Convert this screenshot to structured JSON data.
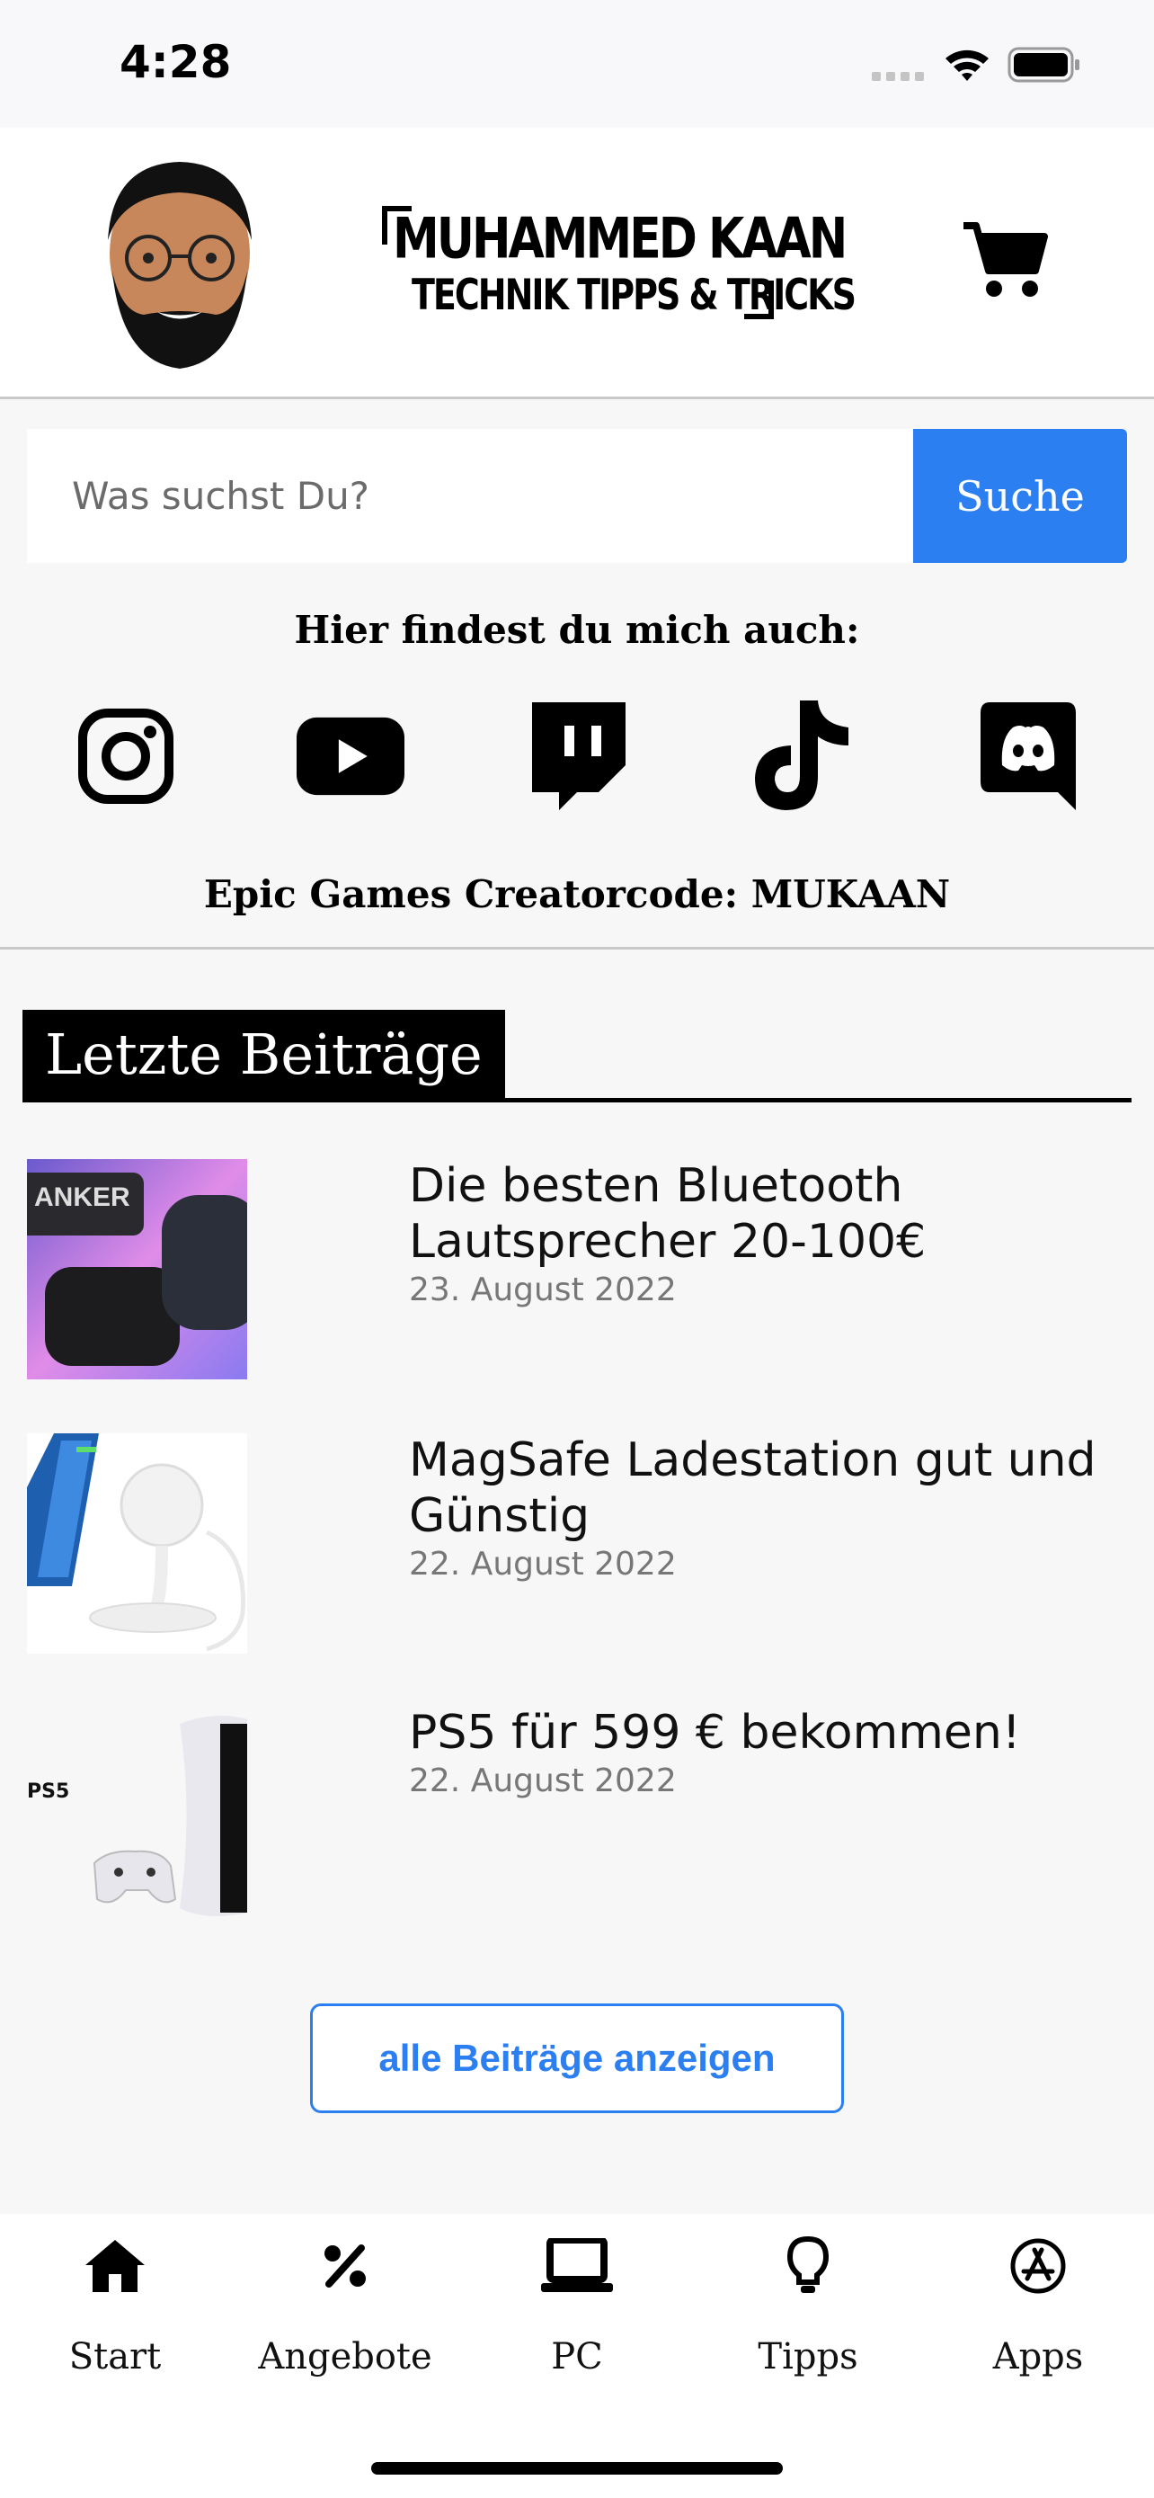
{
  "status_bar": {
    "time": "4:28"
  },
  "header": {
    "logo_line1": "MUHAMMED KAAN",
    "logo_line2": "TECHNIK TIPPS & TRICKS"
  },
  "search": {
    "placeholder": "Was suchst Du?",
    "button_label": "Suche"
  },
  "social": {
    "heading": "Hier findest du mich auch:",
    "icons": [
      "instagram-icon",
      "youtube-icon",
      "twitch-icon",
      "tiktok-icon",
      "discord-icon"
    ]
  },
  "creator_code": "Epic Games Creatorcode: MUKAAN",
  "section": {
    "title": "Letzte Beiträge"
  },
  "posts": [
    {
      "title": "Die besten Bluetooth Lautsprecher 20-100€",
      "date": "23. August 2022",
      "thumb_text": "ANKER"
    },
    {
      "title": "MagSafe Ladestation gut und Günstig",
      "date": "22. August 2022"
    },
    {
      "title": "PS5 für 599 € bekommen!",
      "date": "22. August 2022",
      "thumb_text": "PS5"
    }
  ],
  "all_posts_label": "alle Beiträge anzeigen",
  "tabs": [
    {
      "label": "Start",
      "icon": "home-icon"
    },
    {
      "label": "Angebote",
      "icon": "percent-icon"
    },
    {
      "label": "PC",
      "icon": "laptop-icon"
    },
    {
      "label": "Tipps",
      "icon": "lightbulb-icon"
    },
    {
      "label": "Apps",
      "icon": "app-store-icon"
    }
  ],
  "colors": {
    "accent": "#2b7ff0",
    "background": "#f7f7f7"
  }
}
